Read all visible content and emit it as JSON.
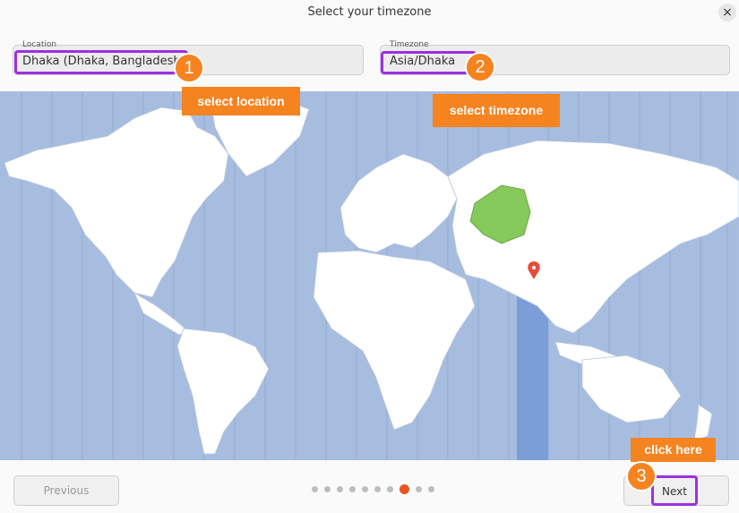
{
  "window": {
    "title": "Select your timezone",
    "close_symbol": "×"
  },
  "location": {
    "label": "Location",
    "value": "Dhaka (Dhaka, Bangladesh)"
  },
  "timezone": {
    "label": "Timezone",
    "value": "Asia/Dhaka"
  },
  "annotations": {
    "step1": {
      "number": "1",
      "text": "select location"
    },
    "step2": {
      "number": "2",
      "text": "select timezone"
    },
    "step3": {
      "number": "3",
      "text": "click here"
    }
  },
  "footer": {
    "previous_label": "Previous",
    "next_label": "Next",
    "pagination": {
      "total": 10,
      "current": 8
    }
  },
  "colors": {
    "ocean": "#a7bde0",
    "land": "#ffffff",
    "selected_region": "#86c95b",
    "selected_zone_band": "#7b9ed8",
    "accent": "#e95420",
    "callout": "#f5831f",
    "highlight": "#9b30e0"
  }
}
